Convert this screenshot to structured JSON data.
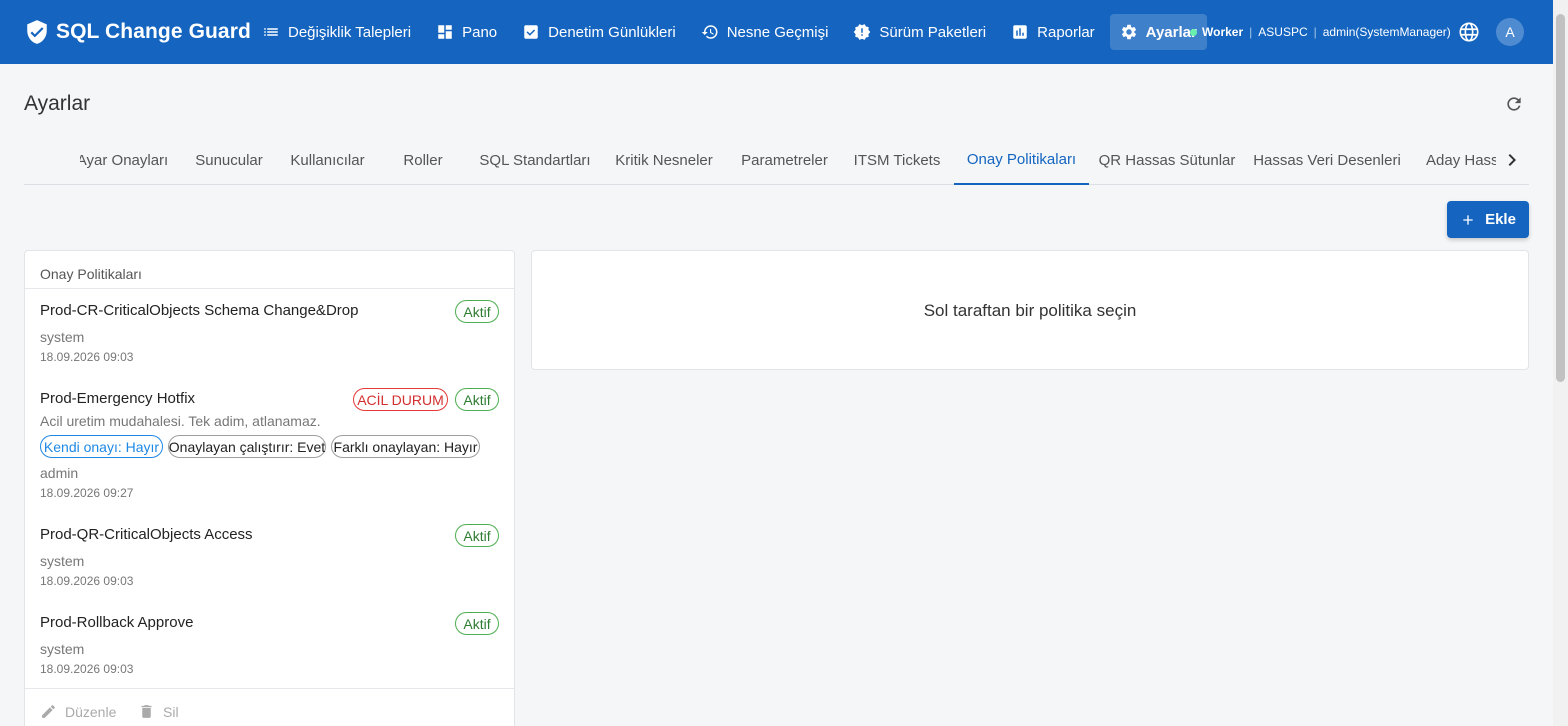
{
  "app": {
    "title": "SQL Change Guard",
    "colors": {
      "primary": "#1565c0",
      "active_chip": "#4caf50",
      "emergency_chip": "#e53935"
    }
  },
  "nav": {
    "items": [
      {
        "label": "Değişiklik Talepleri",
        "icon": "list-icon"
      },
      {
        "label": "Pano",
        "icon": "dashboard-icon"
      },
      {
        "label": "Denetim Günlükleri",
        "icon": "checklist-icon"
      },
      {
        "label": "Nesne Geçmişi",
        "icon": "history-icon"
      },
      {
        "label": "Sürüm Paketleri",
        "icon": "release-icon"
      },
      {
        "label": "Raporlar",
        "icon": "report-icon"
      },
      {
        "label": "Ayarlar",
        "icon": "gear-icon",
        "active": true
      }
    ]
  },
  "status": {
    "worker": "Worker",
    "host": "ASUSPC",
    "user": "admin(SystemManager)",
    "avatar_letter": "A"
  },
  "page": {
    "title": "Ayarlar"
  },
  "tabs": [
    "Ayar Onayları",
    "Sunucular",
    "Kullanıcılar",
    "Roller",
    "SQL Standartları",
    "Kritik Nesneler",
    "Parametreler",
    "ITSM Tickets",
    "Onay Politikaları",
    "QR Hassas Sütunlar",
    "Hassas Veri Desenleri",
    "Aday Hassas"
  ],
  "active_tab": "Onay Politikaları",
  "actions": {
    "add_label": "Ekle"
  },
  "policies_panel": {
    "title": "Onay Politikaları",
    "items": [
      {
        "name": "Prod-CR-CriticalObjects Schema Change&Drop",
        "status": "Aktif",
        "owner": "system",
        "date": "18.09.2026 09:03"
      },
      {
        "name": "Prod-Emergency Hotfix",
        "badge": "ACİL DURUM",
        "status": "Aktif",
        "description": "Acil uretim mudahalesi. Tek adim, atlanamaz.",
        "tags": [
          "Kendi onayı: Hayır",
          "Onaylayan çalıştırır: Evet",
          "Farklı onaylayan: Hayır"
        ],
        "owner": "admin",
        "date": "18.09.2026 09:27"
      },
      {
        "name": "Prod-QR-CriticalObjects Access",
        "status": "Aktif",
        "owner": "system",
        "date": "18.09.2026 09:03"
      },
      {
        "name": "Prod-Rollback Approve",
        "status": "Aktif",
        "owner": "system",
        "date": "18.09.2026 09:03"
      }
    ],
    "edit_label": "Düzenle",
    "delete_label": "Sil"
  },
  "detail_panel": {
    "empty_message": "Sol taraftan bir politika seçin"
  }
}
